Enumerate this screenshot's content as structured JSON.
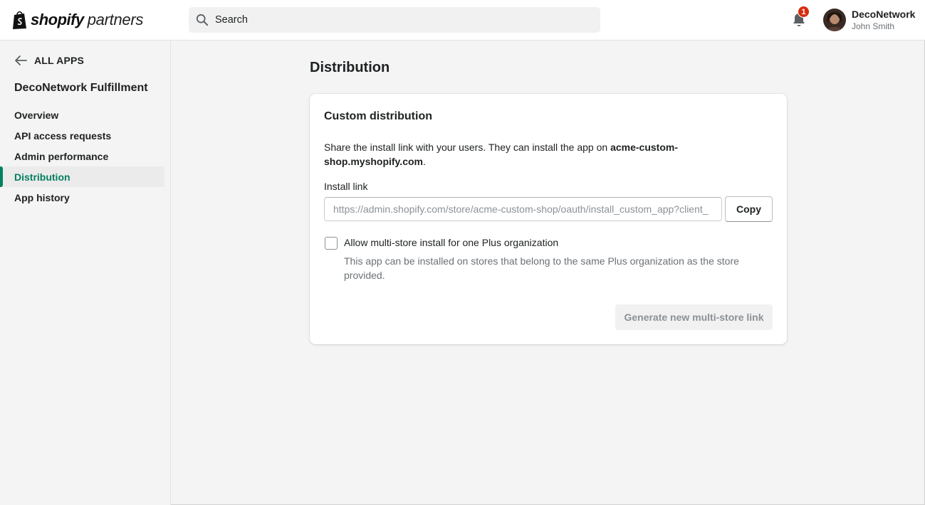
{
  "header": {
    "logo_word1": "shopify",
    "logo_word2": "partners",
    "search_placeholder": "Search",
    "notification_count": "1",
    "org_name": "DecoNetwork",
    "user_name": "John Smith"
  },
  "sidebar": {
    "back_label": "ALL APPS",
    "app_name": "DecoNetwork Fulfillment",
    "items": [
      {
        "label": "Overview"
      },
      {
        "label": "API access requests"
      },
      {
        "label": "Admin performance"
      },
      {
        "label": "Distribution",
        "active": true
      },
      {
        "label": "App history"
      }
    ]
  },
  "main": {
    "page_title": "Distribution",
    "card": {
      "title": "Custom distribution",
      "description_text": "Share the install link with your users. They can install the app on ",
      "description_domain": "acme-custom-shop.myshopify.com",
      "description_end": ".",
      "install_link_label": "Install link",
      "install_link_value": "https://admin.shopify.com/store/acme-custom-shop/oauth/install_custom_app?client_",
      "copy_label": "Copy",
      "checkbox_label": "Allow multi-store install for one Plus organization",
      "checkbox_checked": false,
      "help_text": "This app can be installed on stores that belong to the same Plus organization as the store provided.",
      "generate_label": "Generate new multi-store link"
    }
  },
  "colors": {
    "accent": "#008060",
    "badge": "#d72c0d"
  }
}
